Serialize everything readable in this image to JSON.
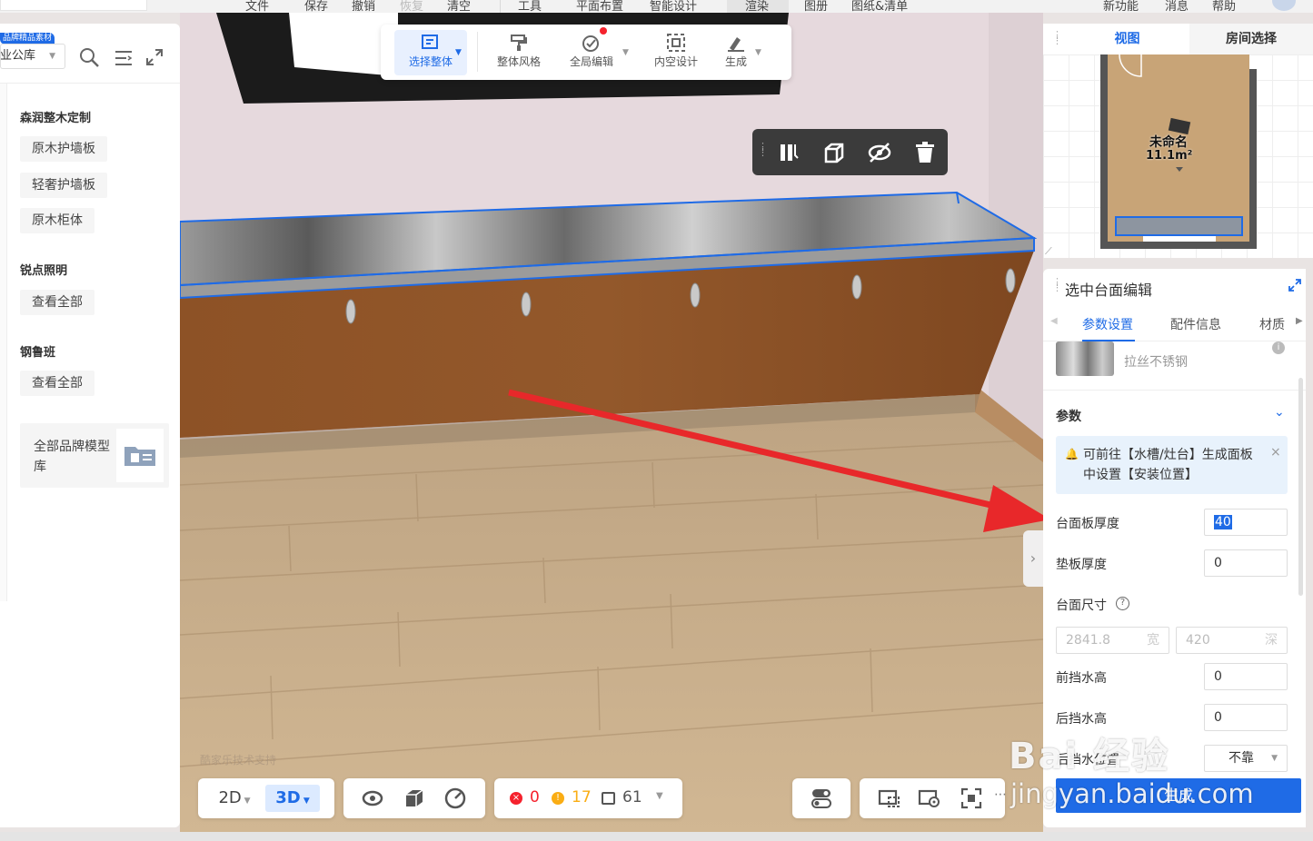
{
  "menubar": {
    "items": [
      "文件",
      "保存",
      "撤销",
      "恢复",
      "清空",
      "工具",
      "平面布置",
      "智能设计",
      "渲染",
      "图册",
      "图纸&清单",
      "新功能",
      "消息",
      "帮助"
    ]
  },
  "toolbar": {
    "select_whole": "选择整体",
    "overall_style": "整体风格",
    "global_edit": "全局编辑",
    "interior_design": "内空设计",
    "generate": "生成"
  },
  "left_panel": {
    "badge": "品牌精品素材",
    "library_select": "企业公库",
    "groups": [
      {
        "title": "森润整木定制",
        "tags": [
          "原木护墙板",
          "轻奢护墙板",
          "原木柜体"
        ]
      },
      {
        "title": "锐点照明",
        "tags": [
          "查看全部"
        ]
      },
      {
        "title": "钢鲁班",
        "tags": [
          "查看全部"
        ]
      }
    ],
    "brand_card": "全部品牌模型库"
  },
  "minimap": {
    "tab_view": "视图",
    "tab_room": "房间选择",
    "room_name": "未命名",
    "room_area": "11.1m²"
  },
  "right_panel": {
    "title": "选中台面编辑",
    "tabs": [
      "参数设置",
      "配件信息",
      "材质"
    ],
    "material_name": "拉丝不锈钢",
    "section_title": "参数",
    "notice": "可前往【水槽/灶台】生成面板中设置【安装位置】",
    "fields": {
      "counter_thickness_label": "台面板厚度",
      "counter_thickness_value": "40",
      "pad_thickness_label": "垫板厚度",
      "pad_thickness_value": "0",
      "size_label": "台面尺寸",
      "width_value": "2841.8",
      "width_unit": "宽",
      "depth_value": "420",
      "depth_unit": "深",
      "front_splash_label": "前挡水高",
      "front_splash_value": "0",
      "back_splash_label": "后挡水高",
      "back_splash_value": "0",
      "back_pos_label": "后挡水位置",
      "back_pos_value": "不靠"
    },
    "generate_button": "生成"
  },
  "bottom_bar": {
    "mode_2d": "2D",
    "mode_3d": "3D",
    "errors": "0",
    "warnings": "17",
    "items": "61"
  },
  "canvas": {
    "support_text": "酷家乐技术支持"
  },
  "watermark": {
    "line1": "Bai 经验",
    "line2": "jingyan.baidu.com"
  },
  "colors": {
    "accent": "#1f6be6",
    "arrow": "#e8282a",
    "cabinet": "#8a4f24",
    "floor": "#c9ab86",
    "wall": "#e6dade"
  }
}
